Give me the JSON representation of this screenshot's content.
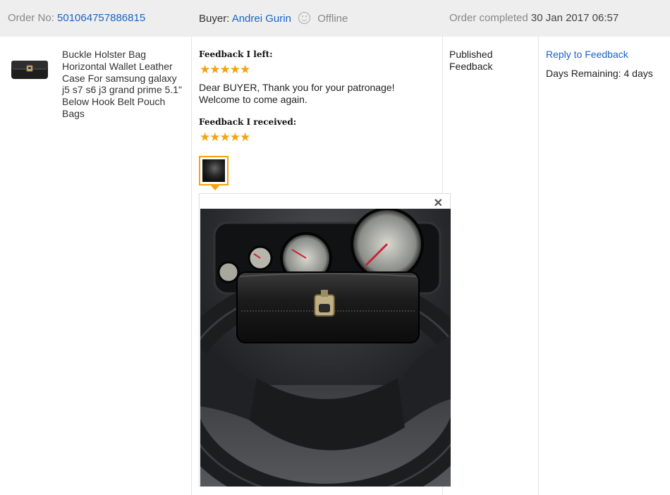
{
  "header": {
    "order_no_label": "Order No:",
    "order_no": "501064757886815",
    "buyer_label": "Buyer:",
    "buyer_name": "Andrei Gurin",
    "buyer_status": "Offline",
    "completed_label": "Order completed",
    "completed_date": "30 Jan 2017 06:57"
  },
  "product": {
    "title": "Buckle Holster Bag Horizontal Wallet Leather Case For samsung galaxy j5 s7 s6 j3 grand prime 5.1\" Below Hook Belt Pouch Bags"
  },
  "feedback": {
    "left_heading": "Feedback I left:",
    "left_rating": 5,
    "left_text": "Dear BUYER, Thank you for your patronage! Welcome to come again.",
    "received_heading": "Feedback I received:",
    "received_rating": 5
  },
  "status": {
    "text": "Published Feedback"
  },
  "actions": {
    "reply_label": "Reply to Feedback",
    "days_remaining": "Days Remaining: 4 days"
  },
  "colors": {
    "link": "#1a63c6",
    "star": "#f4a30d",
    "header_bg": "#eeeeee"
  },
  "icons": {
    "offline": "offline-face-icon",
    "close": "close-icon",
    "star": "star-icon"
  }
}
